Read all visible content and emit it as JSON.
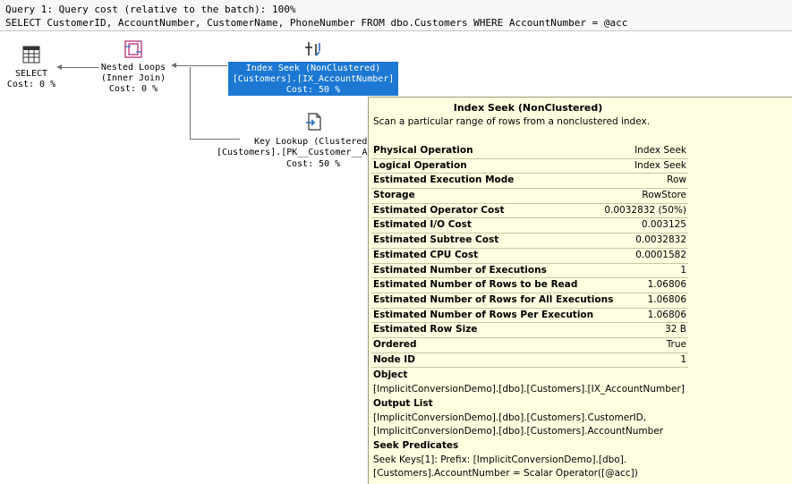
{
  "query": {
    "line1": "Query 1: Query cost (relative to the batch): 100%",
    "line2": "SELECT CustomerID, AccountNumber, CustomerName, PhoneNumber FROM dbo.Customers WHERE AccountNumber = @acc"
  },
  "plan": {
    "select": {
      "name": "SELECT",
      "cost": "Cost: 0 %"
    },
    "nested_loops": {
      "name": "Nested Loops",
      "subtitle": "(Inner Join)",
      "cost": "Cost: 0 %"
    },
    "index_seek": {
      "name": "Index Seek (NonClustered)",
      "object": "[Customers].[IX_AccountNumber]",
      "cost": "Cost: 50 %"
    },
    "key_lookup": {
      "name": "Key Lookup (Clustered",
      "object": "[Customers].[PK__Customer__A",
      "cost": "Cost: 50 %"
    }
  },
  "tooltip": {
    "title": "Index Seek (NonClustered)",
    "description": "Scan a particular range of rows from a nonclustered index.",
    "properties": [
      {
        "label": "Physical Operation",
        "value": "Index Seek"
      },
      {
        "label": "Logical Operation",
        "value": "Index Seek"
      },
      {
        "label": "Estimated Execution Mode",
        "value": "Row"
      },
      {
        "label": "Storage",
        "value": "RowStore"
      },
      {
        "label": "Estimated Operator Cost",
        "value": "0.0032832 (50%)"
      },
      {
        "label": "Estimated I/O Cost",
        "value": "0.003125"
      },
      {
        "label": "Estimated Subtree Cost",
        "value": "0.0032832"
      },
      {
        "label": "Estimated CPU Cost",
        "value": "0.0001582"
      },
      {
        "label": "Estimated Number of Executions",
        "value": "1"
      },
      {
        "label": "Estimated Number of Rows to be Read",
        "value": "1.06806"
      },
      {
        "label": "Estimated Number of Rows for All Executions",
        "value": "1.06806"
      },
      {
        "label": "Estimated Number of Rows Per Execution",
        "value": "1.06806"
      },
      {
        "label": "Estimated Row Size",
        "value": "32 B"
      },
      {
        "label": "Ordered",
        "value": "True"
      },
      {
        "label": "Node ID",
        "value": "1"
      }
    ],
    "object_heading": "Object",
    "object_value": "[ImplicitConversionDemo].[dbo].[Customers].[IX_AccountNumber]",
    "output_heading": "Output List",
    "output_line1": "[ImplicitConversionDemo].[dbo].[Customers].CustomerID,",
    "output_line2": "[ImplicitConversionDemo].[dbo].[Customers].AccountNumber",
    "seek_heading": "Seek Predicates",
    "seek_line1": "Seek Keys[1]: Prefix: [ImplicitConversionDemo].[dbo].",
    "seek_line2": "[Customers].AccountNumber = Scalar Operator([@acc])"
  },
  "icons": {
    "select": "select-icon",
    "nested_loops": "nested-loops-icon",
    "index_seek": "index-seek-icon",
    "key_lookup": "key-lookup-icon"
  },
  "colors": {
    "selected": "#1c78d3",
    "tooltip_bg": "#ffffe1",
    "header_bg": "#f7f7f7"
  }
}
